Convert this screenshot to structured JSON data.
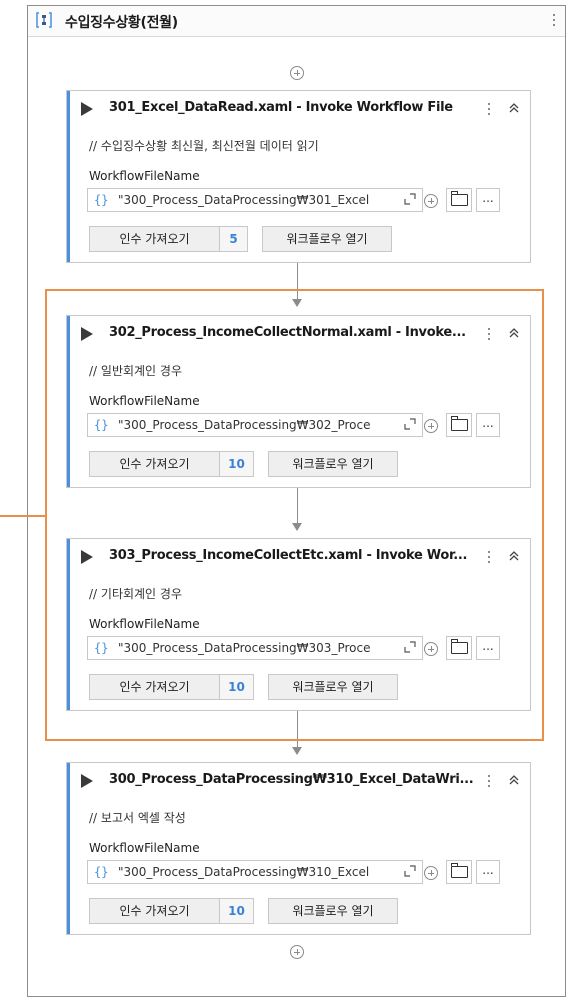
{
  "sequence": {
    "title": "수입징수상황(전월)"
  },
  "activities": [
    {
      "title": "301_Excel_DataRead.xaml - Invoke Workflow File",
      "comment": "// 수입징수상황 최신월, 최신전월 데이터 읽기",
      "property_label": "WorkflowFileName",
      "braces": "{}",
      "file_value": "\"300_Process_DataProcessing₩301_Excel",
      "import_label": "인수 가져오기",
      "arg_count": "5",
      "open_label": "워크플로우 열기",
      "more_label": "..."
    },
    {
      "title": "302_Process_IncomeCollectNormal.xaml - Invoke...",
      "comment": "// 일반회계인 경우",
      "property_label": "WorkflowFileName",
      "braces": "{}",
      "file_value": "\"300_Process_DataProcessing₩302_Proce",
      "import_label": "인수 가져오기",
      "arg_count": "10",
      "open_label": "워크플로우 열기",
      "more_label": "..."
    },
    {
      "title": "303_Process_IncomeCollectEtc.xaml - Invoke Wor...",
      "comment": "// 기타회계인 경우",
      "property_label": "WorkflowFileName",
      "braces": "{}",
      "file_value": "\"300_Process_DataProcessing₩303_Proce",
      "import_label": "인수 가져오기",
      "arg_count": "10",
      "open_label": "워크플로우 열기",
      "more_label": "..."
    },
    {
      "title": "300_Process_DataProcessing₩310_Excel_DataWri...",
      "comment": "// 보고서 엑셀 작성",
      "property_label": "WorkflowFileName",
      "braces": "{}",
      "file_value": "\"300_Process_DataProcessing₩310_Excel",
      "import_label": "인수 가져오기",
      "arg_count": "10",
      "open_label": "워크플로우 열기",
      "more_label": "..."
    }
  ],
  "icons": {
    "sequence": "sequence-icon",
    "play": "play-icon",
    "more": "vertical-ellipsis-icon",
    "collapse": "double-chevron-up-icon",
    "expand": "expand-editor-icon",
    "add": "plus-circle-icon",
    "folder": "folder-icon"
  },
  "colors": {
    "accent": "#4a90e2",
    "highlight": "#e8904a",
    "count": "#3b82d6"
  }
}
